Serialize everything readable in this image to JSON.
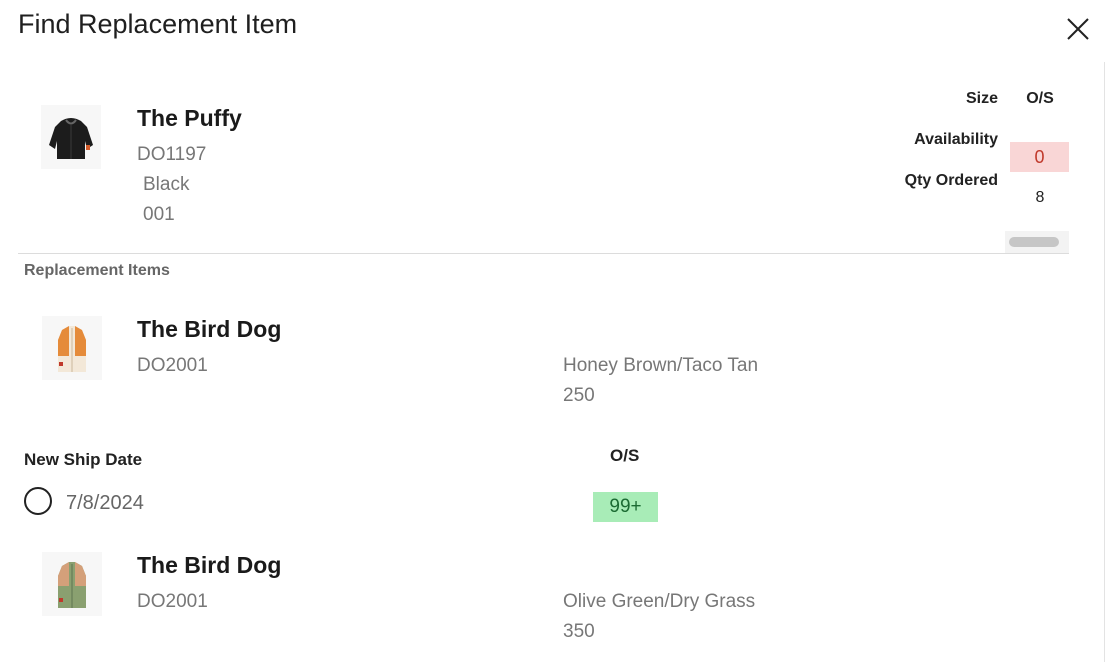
{
  "dialog": {
    "title": "Find Replacement Item",
    "close_icon": "close-icon"
  },
  "current_item": {
    "name": "The Puffy",
    "sku": "DO1197",
    "color": "Black",
    "color_code": "001",
    "thumbnail_icon": "black-jacket-icon",
    "size_label": "Size",
    "size_value": "O/S",
    "availability_label": "Availability",
    "availability_value": "0",
    "qty_label": "Qty Ordered",
    "qty_value": "8"
  },
  "replacement": {
    "section_label": "Replacement Items",
    "items": [
      {
        "name": "The Bird Dog",
        "sku": "DO2001",
        "color": "Honey Brown/Taco Tan",
        "color_code": "250",
        "thumbnail_icon": "orange-vest-icon"
      },
      {
        "name": "The Bird Dog",
        "sku": "DO2001",
        "color": "Olive Green/Dry Grass",
        "color_code": "350",
        "thumbnail_icon": "green-vest-icon"
      }
    ],
    "ship_date_label": "New Ship Date",
    "ship_date_value": "7/8/2024",
    "size_header": "O/S",
    "stock_value": "99+"
  },
  "colors": {
    "unavailable_bg": "#f9d6d6",
    "unavailable_text": "#c0392b",
    "available_bg": "#a8ecb7",
    "available_text": "#1c6b33"
  }
}
